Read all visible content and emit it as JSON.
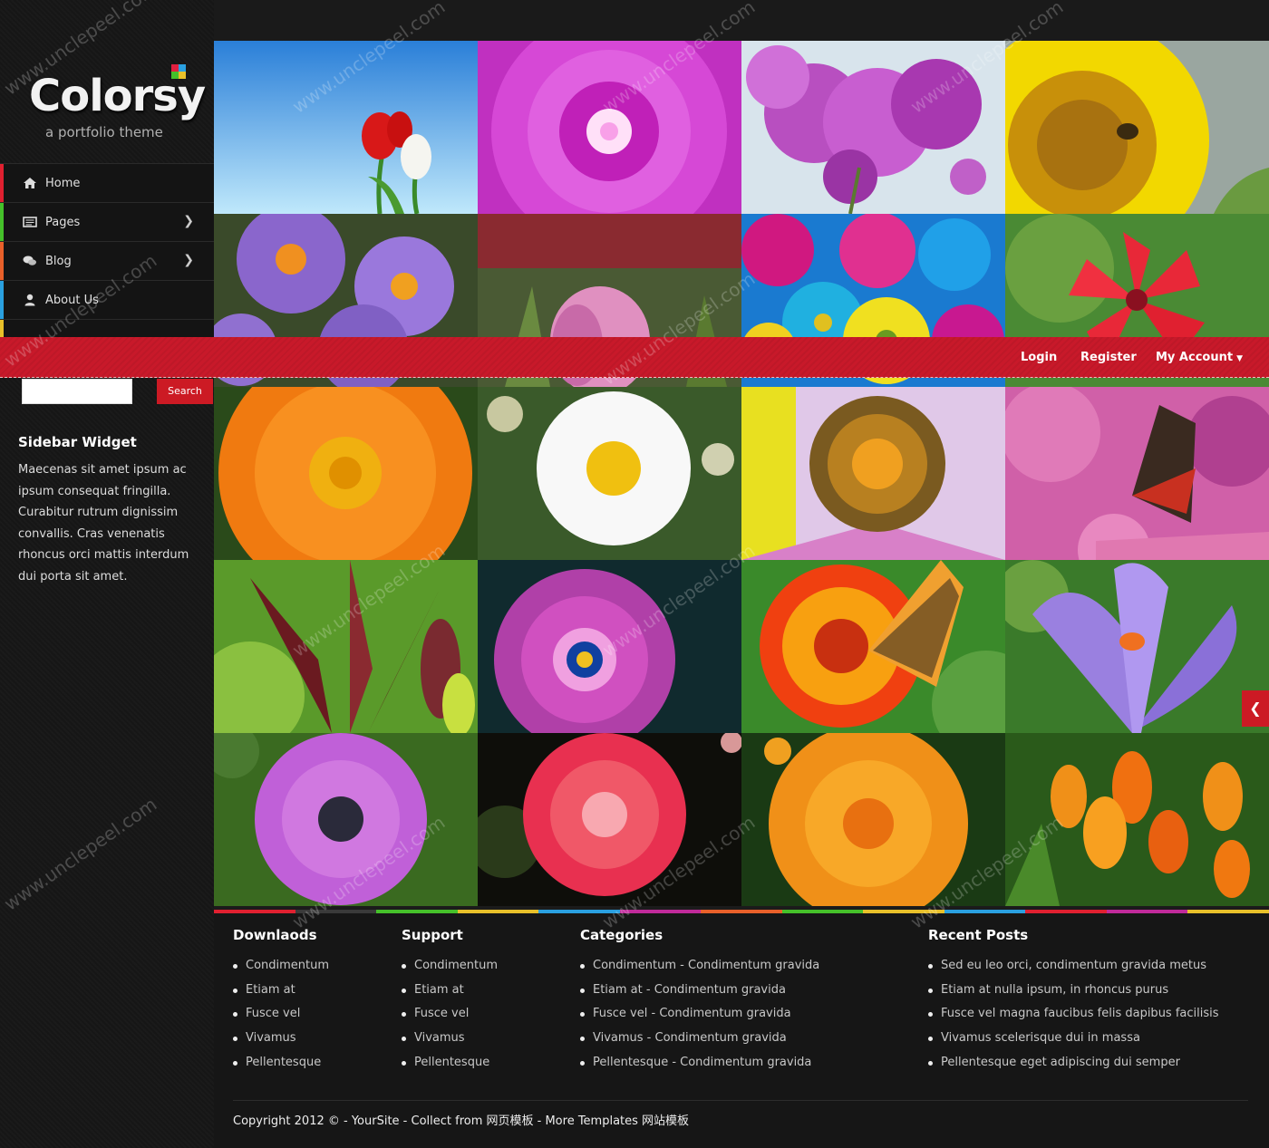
{
  "logo": {
    "title": "Colorsy",
    "tagline": "a portfolio theme"
  },
  "nav": {
    "items": [
      {
        "label": "Home",
        "color": "#e02030",
        "has_submenu": false
      },
      {
        "label": "Pages",
        "color": "#45c02a",
        "has_submenu": true
      },
      {
        "label": "Blog",
        "color": "#e8602a",
        "has_submenu": true
      },
      {
        "label": "About Us",
        "color": "#2aa0e0",
        "has_submenu": false
      }
    ]
  },
  "topbar": {
    "login": "Login",
    "register": "Register",
    "my_account": "My Account"
  },
  "search": {
    "button_label": "Search",
    "value": ""
  },
  "sidebar_widget": {
    "title": "Sidebar Widget",
    "text": "Maecenas sit amet ipsum ac ipsum consequat fringilla. Curabitur rutrum dignissim convallis. Cras venenatis rhoncus orci mattis interdum dui porta sit amet."
  },
  "gallery": {
    "tiles": [
      {
        "name": "red-tulips"
      },
      {
        "name": "pink-dahlia"
      },
      {
        "name": "bougainvillea"
      },
      {
        "name": "sunflower-bee"
      },
      {
        "name": "purple-asters"
      },
      {
        "name": "pink-tulip"
      },
      {
        "name": "colorful-daisies"
      },
      {
        "name": "red-lily"
      },
      {
        "name": "orange-gerbera"
      },
      {
        "name": "white-daisy"
      },
      {
        "name": "echinacea"
      },
      {
        "name": "butterfly-on-flowers"
      },
      {
        "name": "dark-lily"
      },
      {
        "name": "osteospermum"
      },
      {
        "name": "zinnia-monarch"
      },
      {
        "name": "purple-crocus"
      },
      {
        "name": "pink-daisy"
      },
      {
        "name": "red-bellis"
      },
      {
        "name": "orange-dahlia"
      },
      {
        "name": "orange-crocus"
      }
    ]
  },
  "footer": {
    "downloads": {
      "title": "Downlaods",
      "items": [
        "Condimentum",
        "Etiam at",
        "Fusce vel",
        "Vivamus",
        "Pellentesque"
      ]
    },
    "support": {
      "title": "Support",
      "items": [
        "Condimentum",
        "Etiam at",
        "Fusce vel",
        "Vivamus",
        "Pellentesque"
      ]
    },
    "categories": {
      "title": "Categories",
      "items": [
        "Condimentum - Condimentum gravida",
        "Etiam at - Condimentum gravida",
        "Fusce vel - Condimentum gravida",
        "Vivamus - Condimentum gravida",
        "Pellentesque - Condimentum gravida"
      ]
    },
    "recent_posts": {
      "title": "Recent Posts",
      "items": [
        "Sed eu leo orci, condimentum gravida metus",
        "Etiam at nulla ipsum, in rhoncus purus",
        "Fusce vel magna faucibus felis dapibus facilisis",
        "Vivamus scelerisque dui in massa",
        "Pellentesque eget adipiscing dui semper"
      ]
    },
    "copyright": "Copyright 2012 © - YourSite - Collect from 网页模板 - More Templates 网站模板"
  },
  "watermark": "www.unclepeel.com",
  "colors": {
    "accent": "#c8192a",
    "background": "#1b1b1b"
  }
}
